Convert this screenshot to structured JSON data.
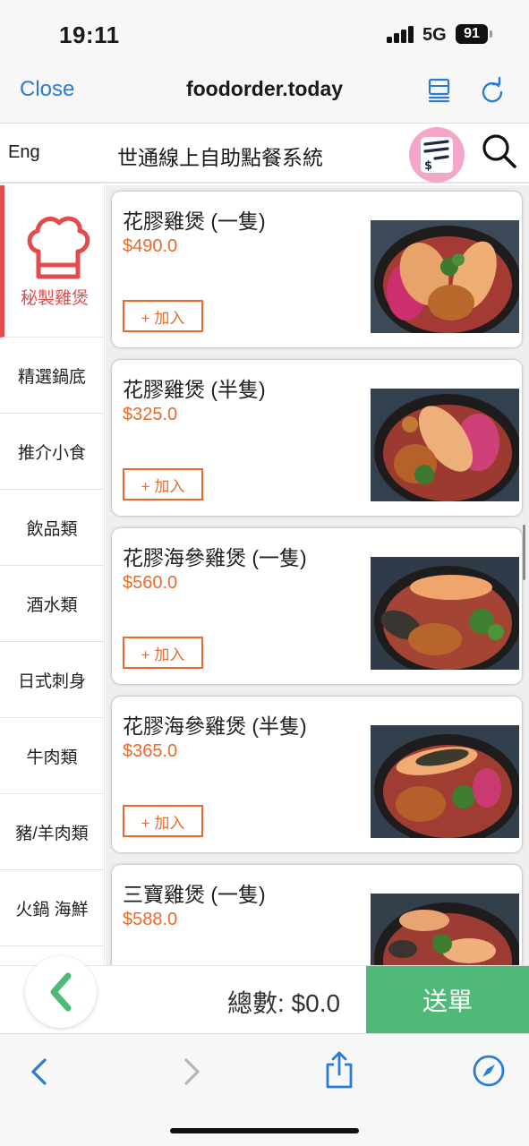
{
  "status_bar": {
    "time": "19:11",
    "network": "5G",
    "battery": "91"
  },
  "browser": {
    "close_label": "Close",
    "url": "foodorder.today"
  },
  "app": {
    "lang_label": "Eng",
    "title": "世通線上自助點餐系統"
  },
  "sidebar": {
    "active": "秘製雞煲",
    "items": [
      "精選鍋底",
      "推介小食",
      "飲品類",
      "酒水類",
      "日式刺身",
      "牛肉類",
      "豬/羊肉類",
      "火鍋 海鮮"
    ]
  },
  "menu": {
    "add_label": "+ 加入",
    "items": [
      {
        "name": "花膠雞煲 (一隻)",
        "price": "$490.0"
      },
      {
        "name": "花膠雞煲 (半隻)",
        "price": "$325.0"
      },
      {
        "name": "花膠海參雞煲 (一隻)",
        "price": "$560.0"
      },
      {
        "name": "花膠海參雞煲 (半隻)",
        "price": "$365.0"
      },
      {
        "name": "三寶雞煲 (一隻)",
        "price": "$588.0"
      }
    ]
  },
  "footer": {
    "total": "總數: $0.0",
    "submit_label": "送單"
  },
  "colors": {
    "accent_red": "#e24c4c",
    "price_orange": "#e86b2d",
    "submit_green": "#4fba78",
    "ios_blue": "#2a7bd6"
  },
  "icons": {
    "toolbar": [
      "back-arrow-icon",
      "forward-arrow-icon",
      "share-icon",
      "compass-icon"
    ],
    "header": [
      "reader-list-icon",
      "reload-icon",
      "cart-list-icon",
      "search-icon"
    ]
  }
}
